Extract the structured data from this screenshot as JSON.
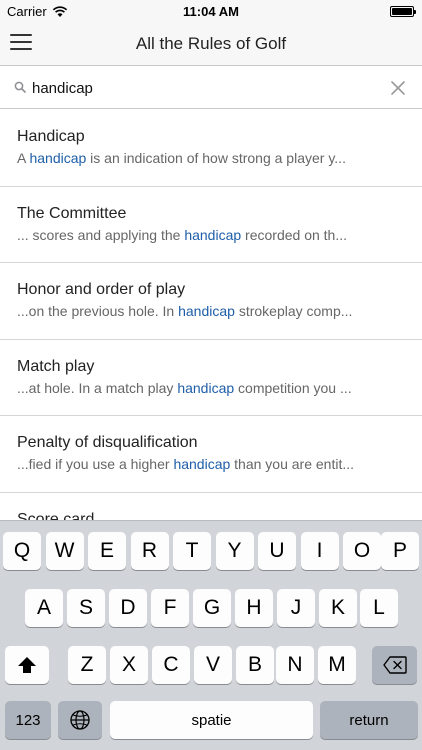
{
  "status": {
    "carrier": "Carrier",
    "time": "11:04 AM"
  },
  "nav": {
    "title": "All the Rules of Golf"
  },
  "search": {
    "value": "handicap"
  },
  "results": [
    {
      "title": "Handicap",
      "pre": "A ",
      "hl": "handicap",
      "post": " is an indication of how strong a player y..."
    },
    {
      "title": "The Committee",
      "pre": "... scores and applying the ",
      "hl": "handicap",
      "post": " recorded on th..."
    },
    {
      "title": "Honor and order of play",
      "pre": "...on the previous hole. In ",
      "hl": "handicap",
      "post": " strokeplay comp..."
    },
    {
      "title": "Match play",
      "pre": "...at hole. In a match play ",
      "hl": "handicap",
      "post": " competition you ..."
    },
    {
      "title": "Penalty of disqualification",
      "pre": "...fied if you use a higher ",
      "hl": "handicap",
      "post": " than you are entit..."
    },
    {
      "title": "Score card",
      "pre": "",
      "hl": "",
      "post": ""
    }
  ],
  "keyboard": {
    "row1": [
      "Q",
      "W",
      "E",
      "R",
      "T",
      "Y",
      "U",
      "I",
      "O",
      "P"
    ],
    "row2": [
      "A",
      "S",
      "D",
      "F",
      "G",
      "H",
      "J",
      "K",
      "L"
    ],
    "row3": [
      "Z",
      "X",
      "C",
      "V",
      "B",
      "N",
      "M"
    ],
    "numbers_label": "123",
    "space_label": "spatie",
    "return_label": "return"
  },
  "icons": {
    "menu": "hamburger-icon",
    "search": "magnifier-icon",
    "clear": "close-icon",
    "shift": "shift-arrow-icon",
    "delete": "backspace-icon",
    "globe": "globe-icon"
  },
  "colors": {
    "highlight": "#1e5ea8",
    "keyboard_bg": "#d1d4d9"
  }
}
